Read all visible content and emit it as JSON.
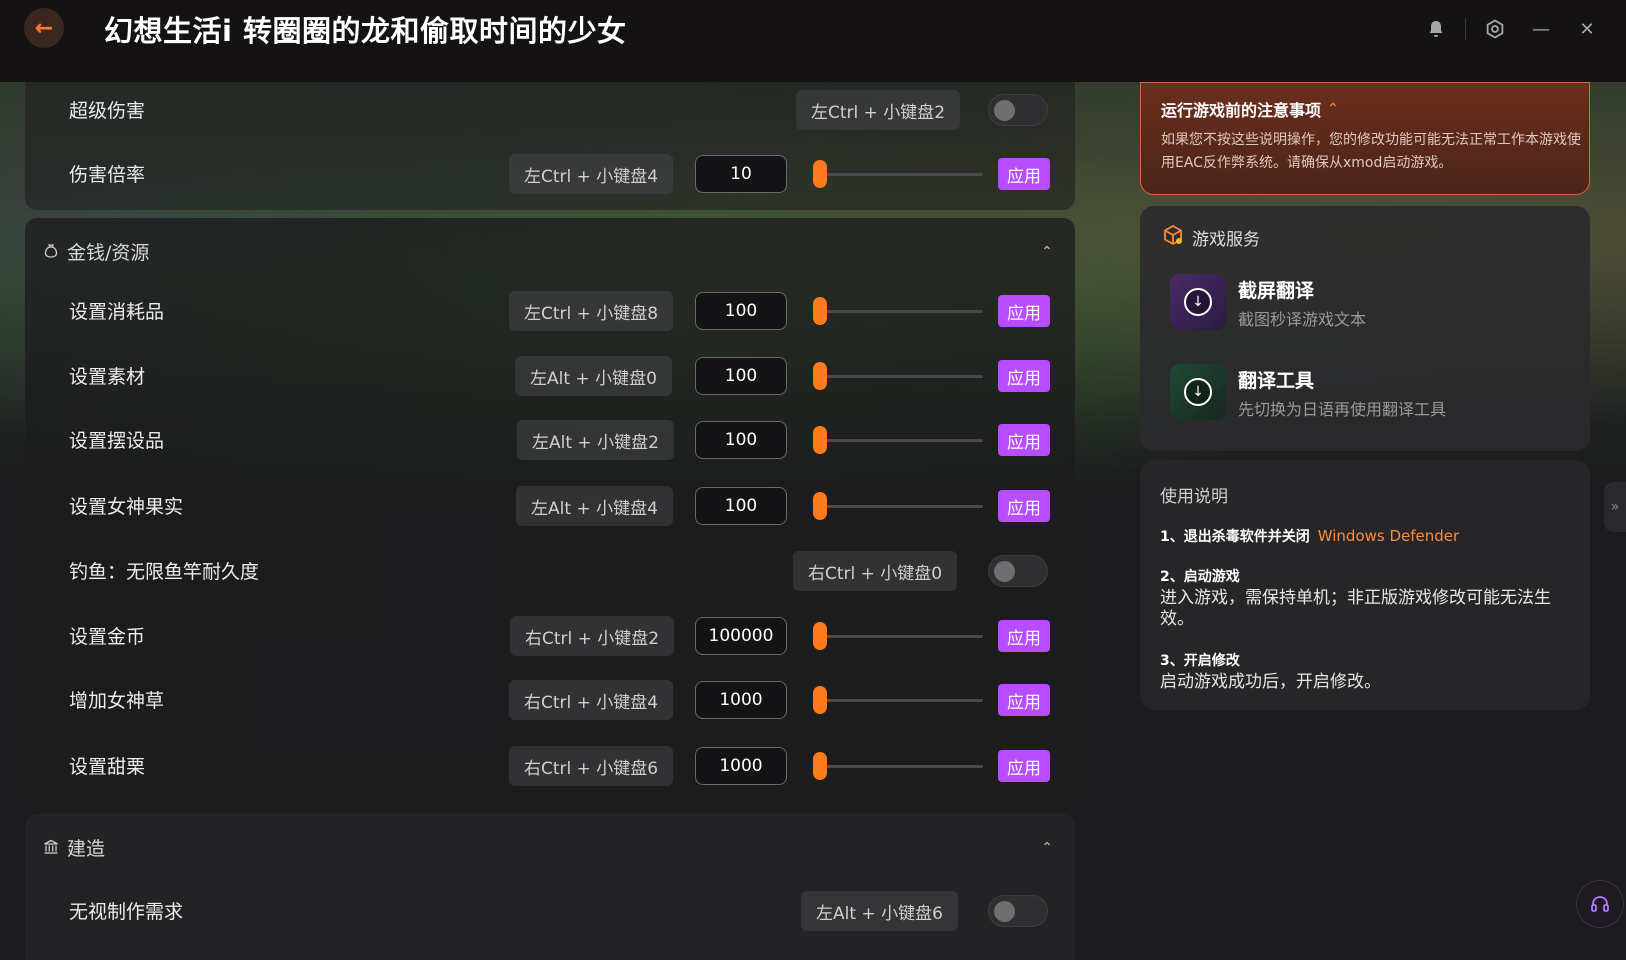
{
  "window": {
    "title": "幻想生活i 转圈圈的龙和偷取时间的少女"
  },
  "sections": {
    "money": {
      "title": "金钱/资源"
    },
    "build": {
      "title": "建造"
    }
  },
  "apply_label": "应用",
  "rows": {
    "super_damage": {
      "label": "超级伤害",
      "hotkey": "左Ctrl + 小键盘2",
      "enabled": false
    },
    "damage_rate": {
      "label": "伤害倍率",
      "hotkey": "左Ctrl + 小键盘4",
      "value": "10"
    },
    "consumables": {
      "label": "设置消耗品",
      "hotkey": "左Ctrl + 小键盘8",
      "value": "100"
    },
    "materials": {
      "label": "设置素材",
      "hotkey": "左Alt + 小键盘0",
      "value": "100"
    },
    "furniture": {
      "label": "设置摆设品",
      "hotkey": "左Alt + 小键盘2",
      "value": "100"
    },
    "goddess_fruit": {
      "label": "设置女神果实",
      "hotkey": "左Alt + 小键盘4",
      "value": "100"
    },
    "fishing": {
      "label": "钓鱼：无限鱼竿耐久度",
      "hotkey": "右Ctrl + 小键盘0",
      "enabled": false
    },
    "gold": {
      "label": "设置金币",
      "hotkey": "右Ctrl + 小键盘2",
      "value": "100000"
    },
    "goddess_grass": {
      "label": "增加女神草",
      "hotkey": "右Ctrl + 小键盘4",
      "value": "1000"
    },
    "chestnut": {
      "label": "设置甜栗",
      "hotkey": "右Ctrl + 小键盘6",
      "value": "1000"
    },
    "ignore_craft": {
      "label": "无视制作需求",
      "hotkey": "左Alt + 小键盘6",
      "enabled": false
    }
  },
  "notice": {
    "title": "运行游戏前的注意事项",
    "text": "如果您不按这些说明操作，您的修改功能可能无法正常工作本游戏使用EAC反作弊系统。请确保从xmod启动游戏。",
    "accent": "#ff7a2e"
  },
  "services": {
    "title": "游戏服务",
    "items": [
      {
        "title": "截屏翻译",
        "subtitle": "截图秒译游戏文本"
      },
      {
        "title": "翻译工具",
        "subtitle": "先切换为日语再使用翻译工具"
      }
    ]
  },
  "usage": {
    "title": "使用说明",
    "steps": [
      {
        "head": "1、退出杀毒软件并关闭",
        "highlight": "Windows Defender",
        "desc": ""
      },
      {
        "head": "2、启动游戏",
        "desc": "进入游戏，需保持单机；非正版游戏修改可能无法生效。"
      },
      {
        "head": "3、开启修改",
        "desc": "启动游戏成功后，开启修改。"
      }
    ]
  },
  "colors": {
    "accent": "#ff7a1a",
    "apply_button": "#b84dff"
  }
}
